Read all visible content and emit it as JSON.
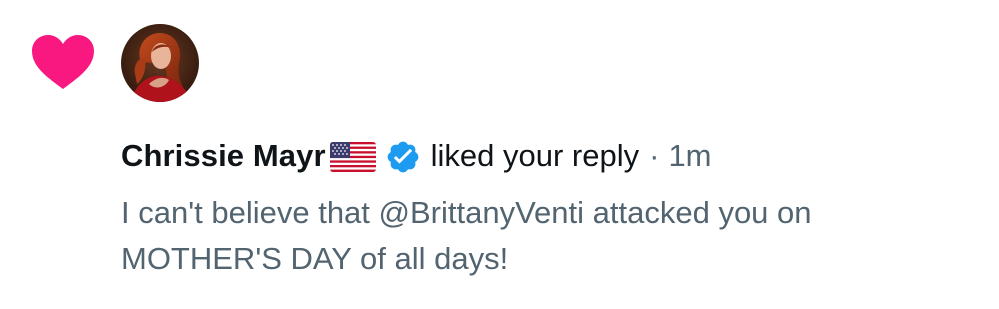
{
  "notification": {
    "type_icon": "heart-icon",
    "avatar_icon": "avatar",
    "user": {
      "name": "Chrissie Mayr",
      "flag_icon": "us-flag-icon",
      "verified_icon": "verified-badge-icon"
    },
    "action": "liked your reply",
    "separator": "·",
    "timestamp": "1m",
    "reply_text": "I can't believe that @BrittanyVenti attacked you on MOTHER'S DAY of all days!"
  },
  "colors": {
    "heart": "#f91880",
    "verified": "#1d9bf0",
    "primary_text": "#0f1419",
    "secondary_text": "#536471",
    "background": "#ffffff"
  }
}
